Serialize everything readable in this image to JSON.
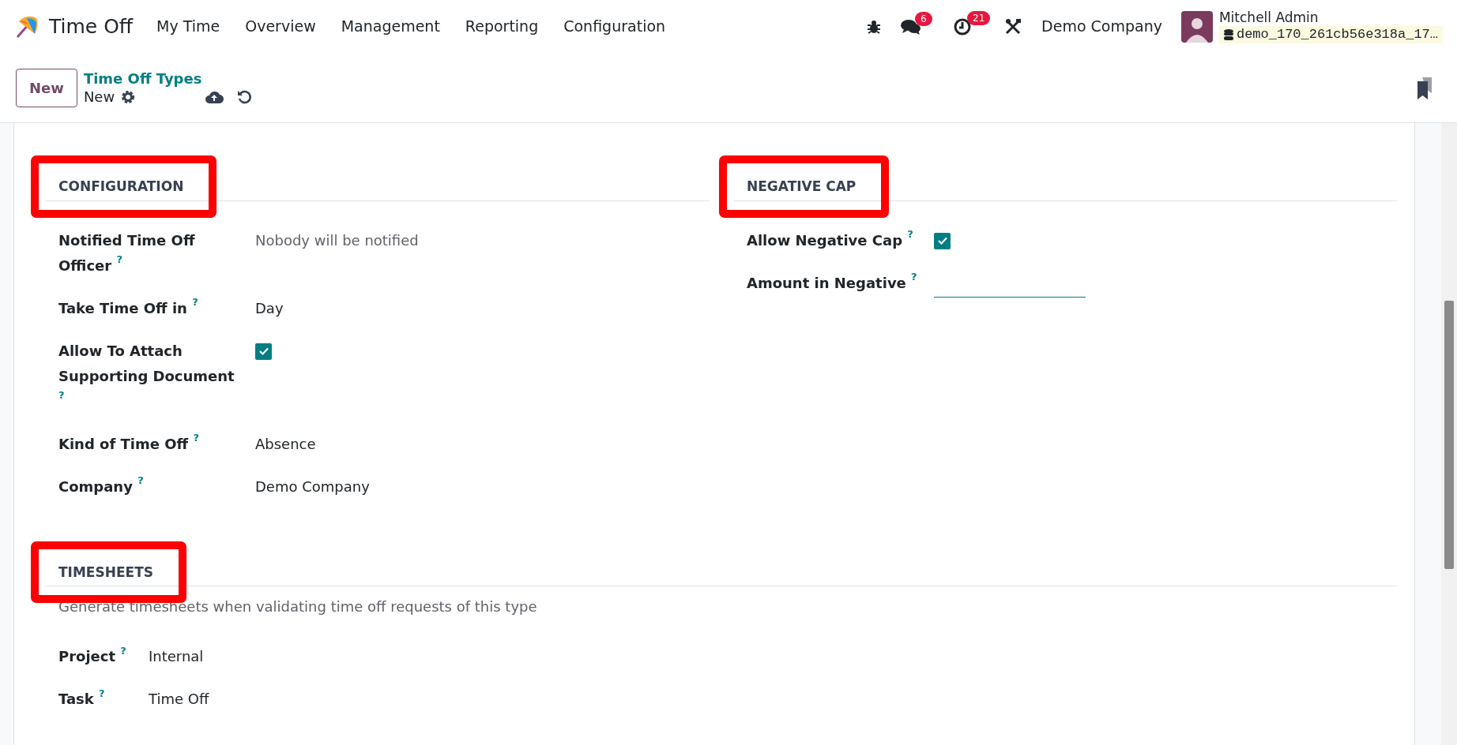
{
  "navbar": {
    "app_name": "Time Off",
    "menu": [
      "My Time",
      "Overview",
      "Management",
      "Reporting",
      "Configuration"
    ],
    "messages_badge": "6",
    "activities_badge": "21",
    "company": "Demo Company",
    "user_name": "Mitchell Admin",
    "database": "demo_170_261cb56e318a_17…"
  },
  "control_panel": {
    "new_button": "New",
    "breadcrumb": "Time Off Types",
    "record_name": "New"
  },
  "sections": [
    {
      "title": "CONFIGURATION",
      "highlighted": true,
      "fields": [
        {
          "label": "Notified Time Off Officer $^{?}$",
          "kind": "text",
          "value": "Nobody will be notified",
          "muted": true
        },
        {
          "label": "Take Time Off in $^{?}$",
          "kind": "text",
          "value": "Day",
          "muted": false
        },
        {
          "label": "Allow To Attach Supporting Document $^{?}$",
          "kind": "checkbox",
          "checked": true
        },
        {
          "label": "Kind of Time Off $^{?}$",
          "kind": "text",
          "value": "Absence",
          "muted": false
        },
        {
          "label": "Company $^{?}$",
          "kind": "text",
          "value": "Demo Company",
          "muted": false
        }
      ]
    },
    {
      "title": "NEGATIVE CAP",
      "highlighted": true,
      "fields": [
        {
          "label": "Allow Negative Cap $^{?}$",
          "kind": "checkbox",
          "checked": true
        },
        {
          "label": "Amount in Negative $^{?}$",
          "kind": "input"
        }
      ]
    }
  ],
  "timesheets": {
    "title": "TIMESHEETS",
    "highlighted": true,
    "description": "Generate timesheets when validating time off requests of this type",
    "fields": [
      {
        "label": "Project $^{?}$",
        "value": "Internal"
      },
      {
        "label": "Task $^{?}$",
        "value": "Time Off"
      }
    ]
  }
}
